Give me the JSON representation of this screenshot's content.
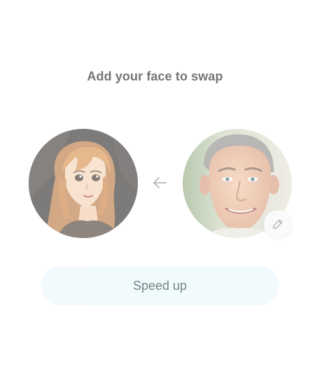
{
  "header": {
    "title": "Add your face to swap"
  },
  "swap": {
    "source_avatar_icon": "anime-girl-portrait",
    "target_avatar_icon": "man-face-photo",
    "arrow_icon": "arrow-left-icon",
    "edit_icon": "pencil-icon"
  },
  "actions": {
    "speed_up_label": "Speed up"
  },
  "colors": {
    "button_background": "#eaf7fd",
    "button_text": "#163b3a",
    "title_text": "#222222"
  }
}
